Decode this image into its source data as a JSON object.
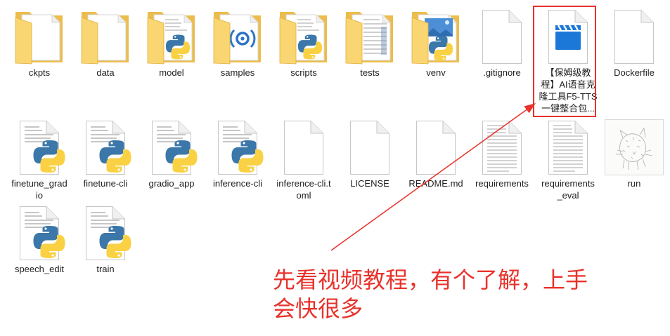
{
  "file_view": {
    "rows": [
      {
        "items": [
          {
            "label_lines": [
              "ckpts"
            ],
            "icon": "folder-icon"
          },
          {
            "label_lines": [
              "data"
            ],
            "icon": "folder-icon"
          },
          {
            "label_lines": [
              "model"
            ],
            "icon": "python-folder-icon"
          },
          {
            "label_lines": [
              "samples"
            ],
            "icon": "audio-folder-icon"
          },
          {
            "label_lines": [
              "scripts"
            ],
            "icon": "python-folder-icon"
          },
          {
            "label_lines": [
              "tests"
            ],
            "icon": "document-folder-icon"
          },
          {
            "label_lines": [
              "venv"
            ],
            "icon": "image-python-folder-icon"
          },
          {
            "label_lines": [
              ".gitignore"
            ],
            "icon": "blank-file-icon"
          },
          {
            "label_lines": [
              "【保姆级教",
              "程】AI语音克",
              "隆工具F5-TTS",
              "一键整合包..."
            ],
            "icon": "video-file-icon"
          },
          {
            "label_lines": [
              "Dockerfile"
            ],
            "icon": "blank-file-icon"
          }
        ]
      },
      {
        "items": [
          {
            "label_lines": [
              "finetune_grad",
              "io"
            ],
            "icon": "python-file-icon"
          },
          {
            "label_lines": [
              "finetune-cli"
            ],
            "icon": "python-file-icon"
          },
          {
            "label_lines": [
              "gradio_app"
            ],
            "icon": "python-file-icon"
          },
          {
            "label_lines": [
              "inference-cli"
            ],
            "icon": "python-file-icon"
          },
          {
            "label_lines": [
              "inference-cli.t",
              "oml"
            ],
            "icon": "blank-file-icon"
          },
          {
            "label_lines": [
              "LICENSE"
            ],
            "icon": "blank-file-icon"
          },
          {
            "label_lines": [
              "README.md"
            ],
            "icon": "blank-file-icon"
          },
          {
            "label_lines": [
              "requirements"
            ],
            "icon": "text-file-icon"
          },
          {
            "label_lines": [
              "requirements",
              "_eval"
            ],
            "icon": "text-file-icon"
          },
          {
            "label_lines": [
              "run"
            ],
            "icon": "image-thumbnail-icon"
          }
        ]
      },
      {
        "items": [
          {
            "label_lines": [
              "speech_edit"
            ],
            "icon": "python-file-icon"
          },
          {
            "label_lines": [
              "train"
            ],
            "icon": "python-file-icon"
          }
        ]
      }
    ]
  },
  "annotation": {
    "color": "#e8322b",
    "caption_lines": [
      "先看视频教程，有个了解，上手",
      "会快很多"
    ]
  },
  "colors": {
    "background": "#ffffff",
    "label_text": "#1e1e1e",
    "folder_yellow": "#f9d671",
    "python_blue": "#3b77a9",
    "python_yellow": "#f9d143",
    "video_blue": "#1b78d8"
  }
}
